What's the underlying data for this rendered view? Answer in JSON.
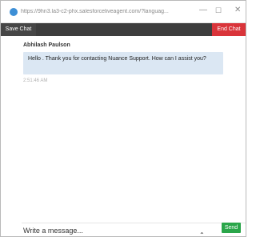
{
  "browser": {
    "url": "https://9hn3.la3-c2-phx.salesforceliveagent.com/?languag...",
    "minimize_glyph": "—",
    "maximize_glyph": "☐",
    "close_glyph": "✕",
    "site_icon": "globe-icon"
  },
  "toolbar": {
    "save_label": "Save Chat",
    "end_label": "End Chat",
    "end_color": "#d9343a"
  },
  "chat": {
    "agent_name": "Abhilash Paulson",
    "message": "Hello . Thank you for contacting Nuance Support.  How can I assist you?",
    "timestamp": "2:51:46 AM"
  },
  "composer": {
    "placeholder": "Write a message...",
    "send_label": "Send",
    "send_color": "#2aa64a"
  }
}
